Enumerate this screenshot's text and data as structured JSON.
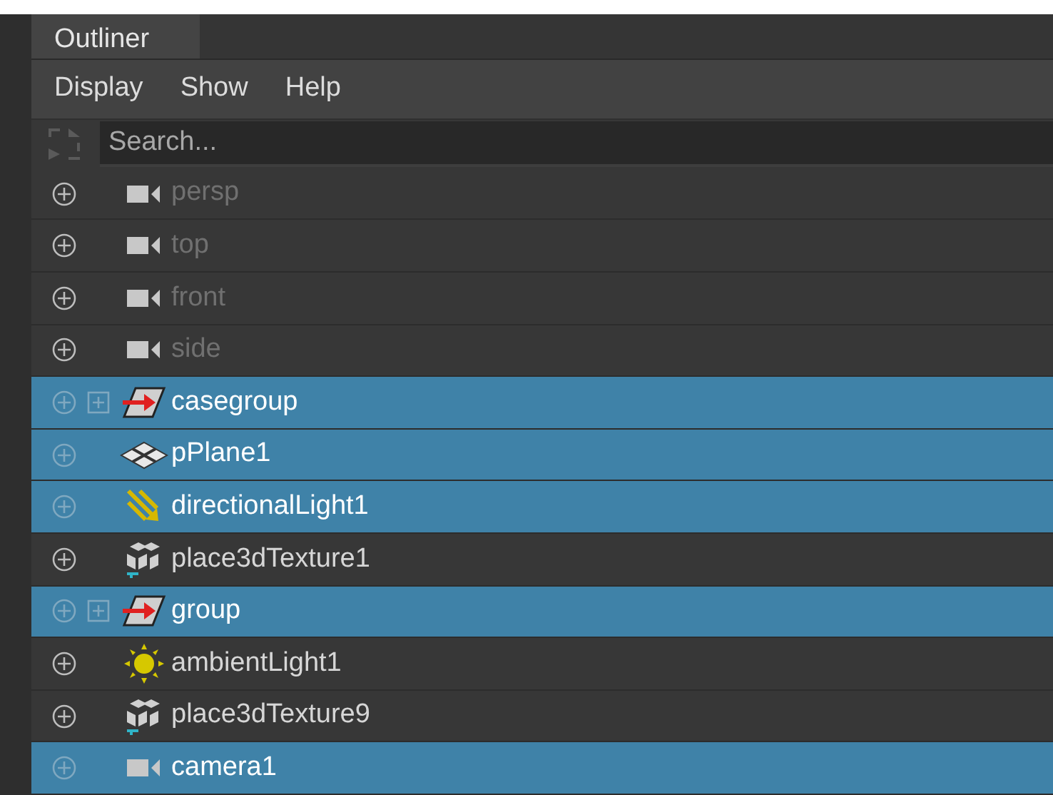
{
  "tabs": [
    {
      "label": "Outliner",
      "selected": true
    }
  ],
  "menu": [
    "Display",
    "Show",
    "Help"
  ],
  "search": {
    "placeholder": "Search..."
  },
  "rows": [
    {
      "name": "persp",
      "kind": "camera",
      "selected": false,
      "dimmed": true,
      "expandable": false
    },
    {
      "name": "top",
      "kind": "camera",
      "selected": false,
      "dimmed": true,
      "expandable": false
    },
    {
      "name": "front",
      "kind": "camera",
      "selected": false,
      "dimmed": true,
      "expandable": false
    },
    {
      "name": "side",
      "kind": "camera",
      "selected": false,
      "dimmed": true,
      "expandable": false
    },
    {
      "name": "casegroup",
      "kind": "group",
      "selected": true,
      "dimmed": false,
      "expandable": true
    },
    {
      "name": "pPlane1",
      "kind": "plane",
      "selected": true,
      "dimmed": false,
      "expandable": false
    },
    {
      "name": "directionalLight1",
      "kind": "directional_light",
      "selected": true,
      "dimmed": false,
      "expandable": false
    },
    {
      "name": "place3dTexture1",
      "kind": "texture",
      "selected": false,
      "dimmed": false,
      "expandable": false
    },
    {
      "name": "group",
      "kind": "group",
      "selected": true,
      "dimmed": false,
      "expandable": true
    },
    {
      "name": "ambientLight1",
      "kind": "ambient_light",
      "selected": false,
      "dimmed": false,
      "expandable": false
    },
    {
      "name": "place3dTexture9",
      "kind": "texture",
      "selected": false,
      "dimmed": false,
      "expandable": false
    },
    {
      "name": "camera1",
      "kind": "camera",
      "selected": true,
      "dimmed": false,
      "expandable": false
    }
  ]
}
